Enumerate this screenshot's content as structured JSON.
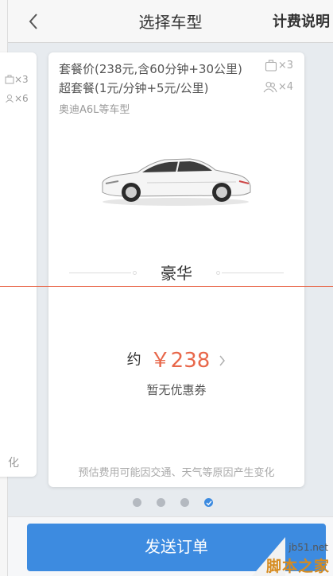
{
  "header": {
    "title": "选择车型",
    "pricing_label": "计费说明"
  },
  "prev_card": {
    "luggage": "×3",
    "passengers": "×6",
    "bottom_text": "化"
  },
  "card": {
    "package_line1": "套餐价(238元,含60分钟+30公里)",
    "package_line2": "超套餐(1元/分钟+5元/公里)",
    "model": "奥迪A6L等车型",
    "luggage": "×3",
    "passengers": "×4",
    "class_label": "豪华",
    "price_prefix": "约",
    "price": "￥238",
    "coupon": "暂无优惠券",
    "disclaimer": "预估费用可能因交通、天气等原因产生变化"
  },
  "pager": {
    "count": 4,
    "active_index": 3
  },
  "footer": {
    "submit_label": "发送订单"
  },
  "watermark": {
    "domain": "jb51.net",
    "name": "脚本之家"
  },
  "colors": {
    "accent": "#3d8be0",
    "price": "#e8674a",
    "page_bg": "#e7ebef"
  },
  "icons": [
    "back-arrow-icon",
    "luggage-icon",
    "passenger-icon",
    "car-image",
    "chevron-right-icon",
    "check-icon"
  ]
}
